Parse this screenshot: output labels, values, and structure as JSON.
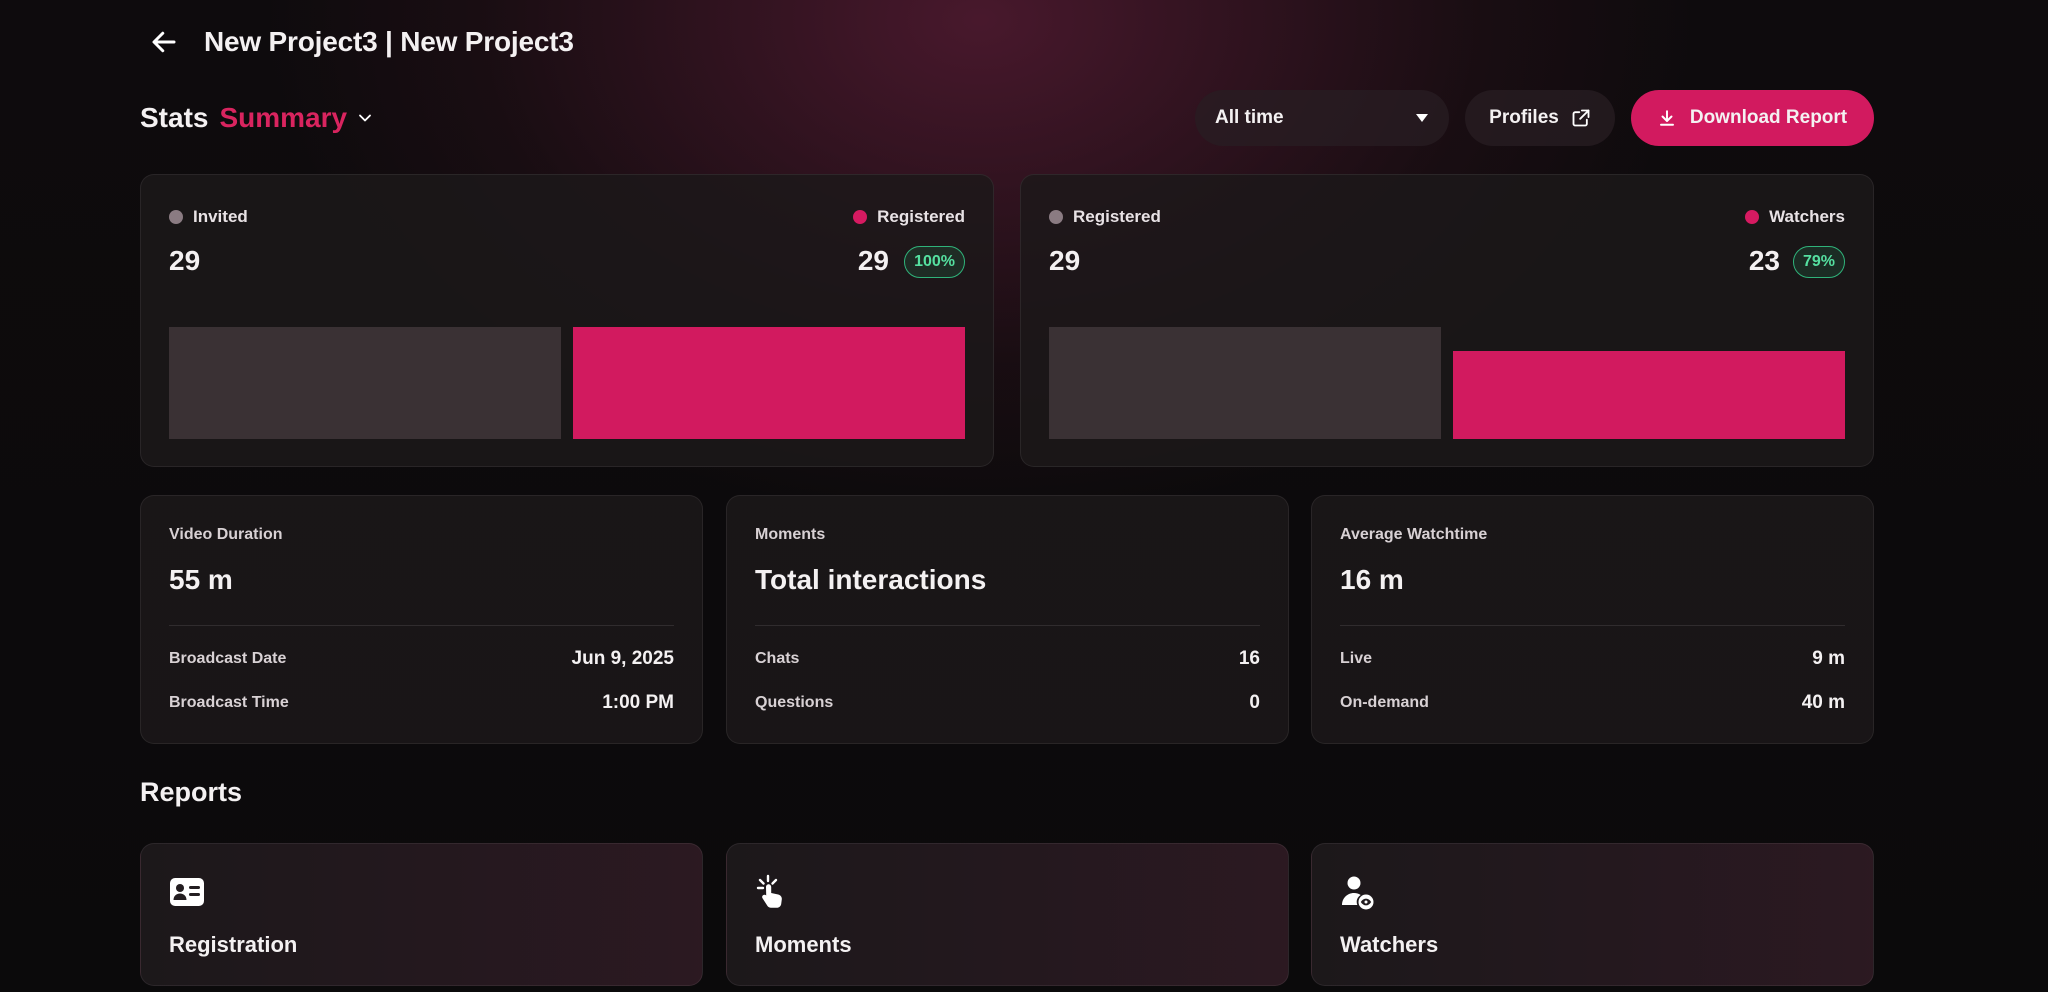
{
  "header": {
    "title": "New Project3 | New Project3",
    "back_icon": "arrow-left-icon"
  },
  "stats": {
    "label": "Stats",
    "view": "Summary",
    "range": {
      "selected": "All time"
    },
    "profiles_label": "Profiles",
    "download_label": "Download Report"
  },
  "funnel": [
    {
      "left": {
        "label": "Invited",
        "value": "29",
        "color": "#8a7b82"
      },
      "right": {
        "label": "Registered",
        "value": "29",
        "percent": "100%",
        "color": "#d61a61"
      },
      "bar_fraction_right": 1.0
    },
    {
      "left": {
        "label": "Registered",
        "value": "29",
        "color": "#8a7b82"
      },
      "right": {
        "label": "Watchers",
        "value": "23",
        "percent": "79%",
        "color": "#d61a61"
      },
      "bar_fraction_right": 0.79
    }
  ],
  "cards": [
    {
      "label": "Video Duration",
      "value": "55 m",
      "rows": [
        {
          "key": "Broadcast Date",
          "value": "Jun 9, 2025"
        },
        {
          "key": "Broadcast Time",
          "value": "1:00 PM"
        }
      ]
    },
    {
      "label": "Moments",
      "value": "Total interactions",
      "rows": [
        {
          "key": "Chats",
          "value": "16"
        },
        {
          "key": "Questions",
          "value": "0"
        }
      ]
    },
    {
      "label": "Average Watchtime",
      "value": "16 m",
      "rows": [
        {
          "key": "Live",
          "value": "9 m"
        },
        {
          "key": "On-demand",
          "value": "40 m"
        }
      ]
    }
  ],
  "reports": {
    "title": "Reports",
    "items": [
      {
        "label": "Registration",
        "icon": "id-card-icon"
      },
      {
        "label": "Moments",
        "icon": "tap-hand-icon"
      },
      {
        "label": "Watchers",
        "icon": "user-eye-icon"
      }
    ]
  },
  "colors": {
    "accent": "#d21a5f",
    "success": "#55e0a0",
    "bar_neutral": "#3a3134"
  }
}
